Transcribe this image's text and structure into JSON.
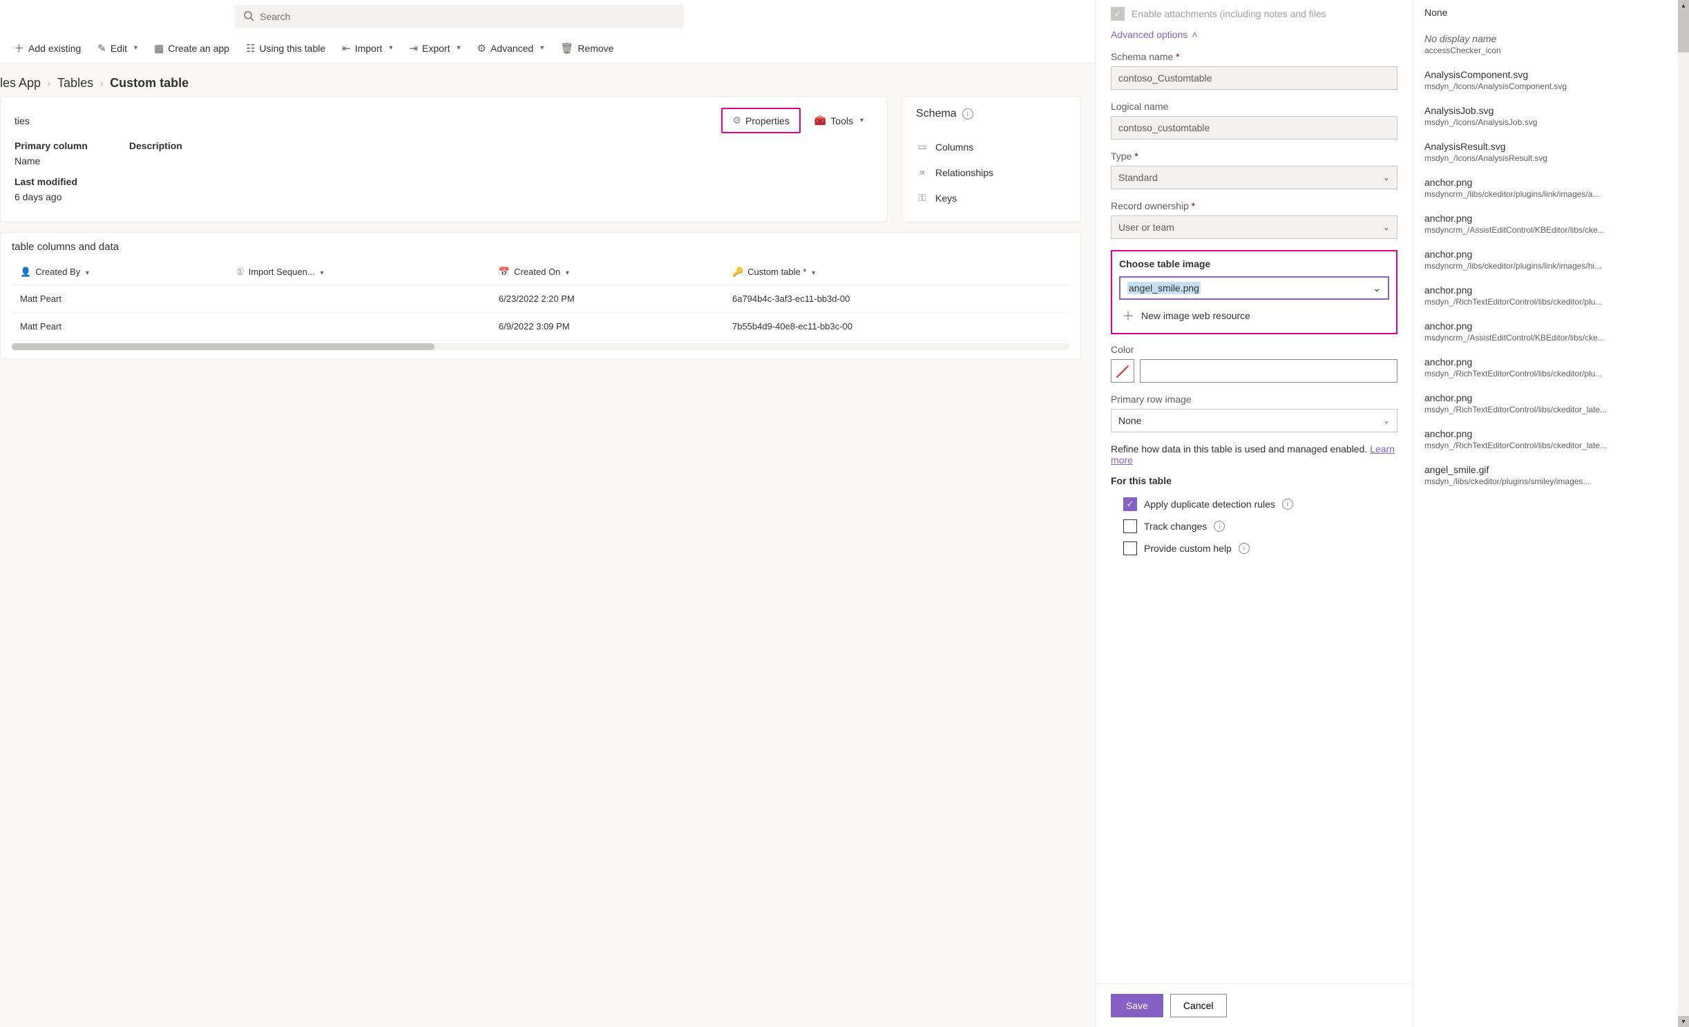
{
  "search": {
    "placeholder": "Search"
  },
  "toolbar": {
    "add_existing": "Add existing",
    "edit": "Edit",
    "create_app": "Create an app",
    "using_table": "Using this table",
    "import": "Import",
    "export": "Export",
    "advanced": "Advanced",
    "remove": "Remove"
  },
  "breadcrumb": {
    "a": "les App",
    "b": "Tables",
    "c": "Custom table"
  },
  "leftcard": {
    "tab": "ties",
    "properties_btn": "Properties",
    "tools_btn": "Tools",
    "primary_col_label": "Primary column",
    "primary_col_val": "Name",
    "desc_label": "Description",
    "lastmod_label": "Last modified",
    "lastmod_val": "6 days ago"
  },
  "schemacard": {
    "title": "Schema",
    "columns": "Columns",
    "relationships": "Relationships",
    "keys": "Keys"
  },
  "datacard": {
    "title": "table columns and data",
    "cols": {
      "created_by": "Created By",
      "import_seq": "Import Sequen...",
      "created_on": "Created On",
      "custom_table": "Custom table"
    },
    "rows": [
      {
        "created_by": "Matt Peart",
        "import_seq": "",
        "created_on": "6/23/2022 2:20 PM",
        "custom_table": "6a794b4c-3af3-ec11-bb3d-00"
      },
      {
        "created_by": "Matt Peart",
        "import_seq": "",
        "created_on": "6/9/2022 3:09 PM",
        "custom_table": "7b55b4d9-40e8-ec11-bb3c-00"
      }
    ]
  },
  "panel": {
    "enable_attach": "Enable attachments (including notes and files",
    "adv_options": "Advanced options",
    "schema_name_lbl": "Schema name",
    "schema_name_val": "contoso_Customtable",
    "logical_name_lbl": "Logical name",
    "logical_name_val": "contoso_customtable",
    "type_lbl": "Type",
    "type_val": "Standard",
    "record_own_lbl": "Record ownership",
    "record_own_val": "User or team",
    "choose_img_lbl": "Choose table image",
    "choose_img_val": "angel_smile.png",
    "new_img_res": "New image web resource",
    "color_lbl": "Color",
    "primary_row_lbl": "Primary row image",
    "primary_row_val": "None",
    "refine_text": "Refine how data in this table is used and managed enabled. ",
    "learn_more": "Learn more",
    "for_this_table": "For this table",
    "opt_dup": "Apply duplicate detection rules",
    "opt_track": "Track changes",
    "opt_help": "Provide custom help",
    "save": "Save",
    "cancel": "Cancel",
    "req": "*"
  },
  "flyout": {
    "none": "None",
    "items": [
      {
        "name": "No display name",
        "path": "accessChecker_icon",
        "italic": true
      },
      {
        "name": "AnalysisComponent.svg",
        "path": "msdyn_/Icons/AnalysisComponent.svg"
      },
      {
        "name": "AnalysisJob.svg",
        "path": "msdyn_/Icons/AnalysisJob.svg"
      },
      {
        "name": "AnalysisResult.svg",
        "path": "msdyn_/Icons/AnalysisResult.svg"
      },
      {
        "name": "anchor.png",
        "path": "msdyncrm_/libs/ckeditor/plugins/link/images/a..."
      },
      {
        "name": "anchor.png",
        "path": "msdyncrm_/AssistEditControl/KBEditor/libs/cke..."
      },
      {
        "name": "anchor.png",
        "path": "msdyncrm_/libs/ckeditor/plugins/link/images/hi..."
      },
      {
        "name": "anchor.png",
        "path": "msdyn_/RichTextEditorControl/libs/ckeditor/plu..."
      },
      {
        "name": "anchor.png",
        "path": "msdyncrm_/AssistEditControl/KBEditor/libs/cke..."
      },
      {
        "name": "anchor.png",
        "path": "msdyn_/RichTextEditorControl/libs/ckeditor/plu..."
      },
      {
        "name": "anchor.png",
        "path": "msdyn_/RichTextEditorControl/libs/ckeditor_late..."
      },
      {
        "name": "anchor.png",
        "path": "msdyn_/RichTextEditorControl/libs/ckeditor_late..."
      },
      {
        "name": "angel_smile.gif",
        "path": "msdyn_/libs/ckeditor/plugins/smiley/images..."
      }
    ]
  }
}
